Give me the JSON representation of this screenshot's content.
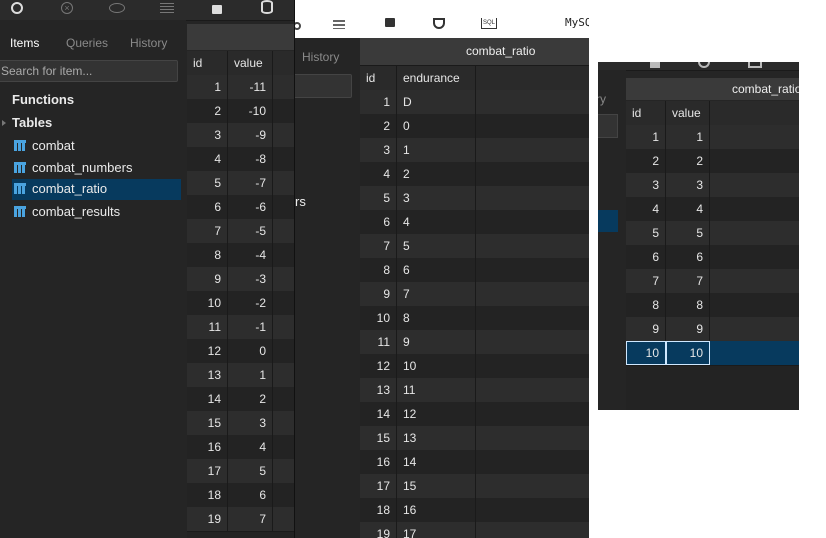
{
  "left_panel": {
    "tabs": [
      "Items",
      "Queries",
      "History"
    ],
    "search_placeholder": "Search for item...",
    "sections": {
      "functions": "Functions",
      "tables": "Tables"
    },
    "tables": [
      "combat",
      "combat_numbers",
      "combat_ratio",
      "combat_results"
    ],
    "selected_table": "combat_ratio",
    "grid": {
      "columns": [
        "id",
        "value"
      ],
      "rows": [
        [
          "1",
          "-11"
        ],
        [
          "2",
          "-10"
        ],
        [
          "3",
          "-9"
        ],
        [
          "4",
          "-8"
        ],
        [
          "5",
          "-7"
        ],
        [
          "6",
          "-6"
        ],
        [
          "7",
          "-5"
        ],
        [
          "8",
          "-4"
        ],
        [
          "9",
          "-3"
        ],
        [
          "10",
          "-2"
        ],
        [
          "11",
          "-1"
        ],
        [
          "12",
          "0"
        ],
        [
          "13",
          "1"
        ],
        [
          "14",
          "2"
        ],
        [
          "15",
          "3"
        ],
        [
          "16",
          "4"
        ],
        [
          "17",
          "5"
        ],
        [
          "18",
          "6"
        ],
        [
          "19",
          "7"
        ]
      ]
    }
  },
  "middle_panel": {
    "history_tab": "History",
    "partial_tree_text": "rs",
    "title_fragment": "MySQ",
    "sql_icon_label": "SQL",
    "table_title": "combat_ratio",
    "grid": {
      "columns": [
        "id",
        "endurance"
      ],
      "rows": [
        [
          "1",
          "D"
        ],
        [
          "2",
          "0"
        ],
        [
          "3",
          "1"
        ],
        [
          "4",
          "2"
        ],
        [
          "5",
          "3"
        ],
        [
          "6",
          "4"
        ],
        [
          "7",
          "5"
        ],
        [
          "8",
          "6"
        ],
        [
          "9",
          "7"
        ],
        [
          "10",
          "8"
        ],
        [
          "11",
          "9"
        ],
        [
          "12",
          "10"
        ],
        [
          "13",
          "11"
        ],
        [
          "14",
          "12"
        ],
        [
          "15",
          "13"
        ],
        [
          "16",
          "14"
        ],
        [
          "17",
          "15"
        ],
        [
          "18",
          "16"
        ],
        [
          "19",
          "17"
        ]
      ]
    }
  },
  "right_panel": {
    "partial_tab": "ry",
    "table_title": "combat_ratio",
    "grid": {
      "columns": [
        "id",
        "value"
      ],
      "rows": [
        [
          "1",
          "1"
        ],
        [
          "2",
          "2"
        ],
        [
          "3",
          "3"
        ],
        [
          "4",
          "4"
        ],
        [
          "5",
          "5"
        ],
        [
          "6",
          "6"
        ],
        [
          "7",
          "7"
        ],
        [
          "8",
          "8"
        ],
        [
          "9",
          "9"
        ],
        [
          "10",
          "10"
        ]
      ],
      "selected_row": 10
    }
  },
  "colors": {
    "selection": "#073a5e",
    "panel_bg": "#252525",
    "accent": "#4aa3df"
  }
}
